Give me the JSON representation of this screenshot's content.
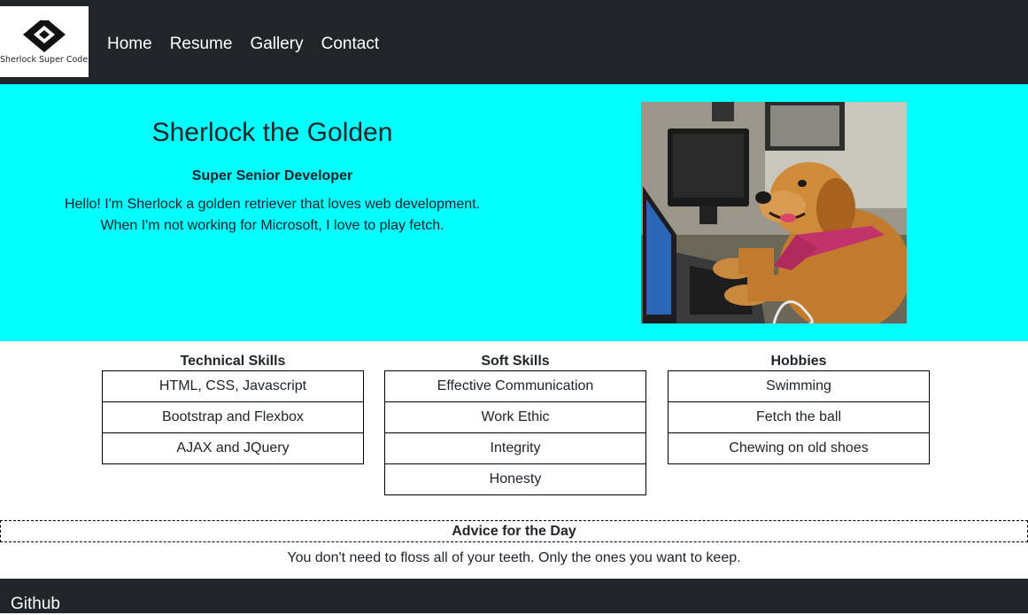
{
  "nav": {
    "logo_text": "Sherlock Super Coder",
    "links": [
      "Home",
      "Resume",
      "Gallery",
      "Contact"
    ]
  },
  "hero": {
    "name": "Sherlock the Golden",
    "role": "Super Senior Developer",
    "bio_line1": "Hello! I'm Sherlock a golden retriever that loves web development.",
    "bio_line2": "When I'm not working for Microsoft, I love to play fetch.",
    "background_color": "#00ffff"
  },
  "skills": {
    "technical": {
      "title": "Technical Skills",
      "items": [
        "HTML, CSS, Javascript",
        "Bootstrap and Flexbox",
        "AJAX and JQuery"
      ]
    },
    "soft": {
      "title": "Soft Skills",
      "items": [
        "Effective Communication",
        "Work Ethic",
        "Integrity",
        "Honesty"
      ]
    },
    "hobbies": {
      "title": "Hobbies",
      "items": [
        "Swimming",
        "Fetch the ball",
        "Chewing on old shoes"
      ]
    }
  },
  "advice": {
    "title": "Advice for the Day",
    "text": "You don't need to floss all of your teeth. Only the ones you want to keep."
  },
  "footer": {
    "link": "Github"
  },
  "colors": {
    "navbar": "#212529",
    "accent": "#00ffff"
  }
}
